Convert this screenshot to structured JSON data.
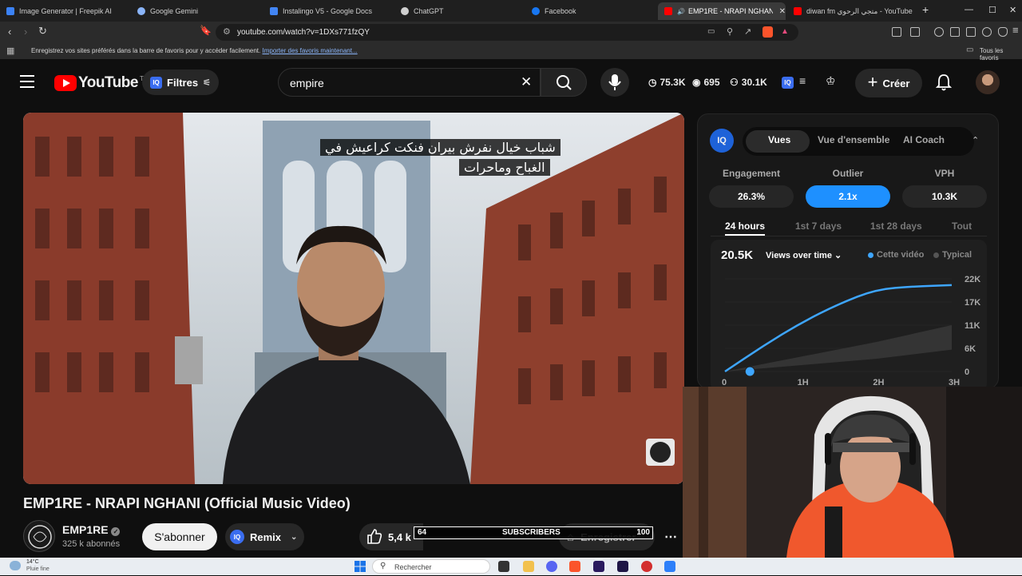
{
  "browser": {
    "tabs": [
      {
        "title": "Image Generator | Freepik AI",
        "favicon_color": "#3b82f6",
        "active": false
      },
      {
        "title": "Google Gemini",
        "favicon_color": "#8ab4f8",
        "active": false
      },
      {
        "title": "Instalingo V5 - Google Docs",
        "favicon_color": "#4285f4",
        "active": false
      },
      {
        "title": "ChatGPT",
        "favicon_color": "#cfcfcf",
        "active": false
      },
      {
        "title": "Facebook",
        "favicon_color": "#1877f2",
        "active": false
      },
      {
        "title": "EMP1RE - NRAPI NGHANI (O",
        "favicon_color": "#ff0000",
        "active": true
      },
      {
        "title": "diwan fm متجي الرحوي - YouTube",
        "favicon_color": "#ff0000",
        "active": false
      }
    ],
    "new_tab": "+",
    "url": "youtube.com/watch?v=1DXs771fzQY",
    "bookmarks_hint": "Enregistrez vos sites préférés dans la barre de favoris pour y accéder facilement.",
    "bookmarks_link": "Importer des favoris maintenant...",
    "all_favorites": "Tous les favoris"
  },
  "youtube": {
    "logo_text": "YouTube",
    "logo_region": "TN",
    "filters_label": "Filtres",
    "search_value": "empire",
    "header_stats": [
      {
        "icon": "clock-icon",
        "value": "75.3K"
      },
      {
        "icon": "eye-icon",
        "value": "695"
      },
      {
        "icon": "people-icon",
        "value": "30.1K"
      }
    ],
    "create_label": "Créer",
    "video": {
      "subtitle_line1": "شباب خيال نفرش بيران فنكت كراعيش في",
      "subtitle_line2": "الغباح وماحرات",
      "title": "EMP1RE - NRAPI NGHANI (Official Music Video)"
    },
    "channel": {
      "name": "EMP1RE",
      "subscribers": "325 k abonnés",
      "subscribe_label": "S'abonner",
      "remix_label": "Remix",
      "likes": "5,4 k",
      "save_label": "Enregistrer"
    },
    "overlay_bar": {
      "left": "64",
      "center": "SUBSCRIBERS",
      "right": "100"
    }
  },
  "panel": {
    "tabs": [
      "Vues",
      "Vue d'ensemble",
      "AI Coach"
    ],
    "active_tab": "Vues",
    "metrics": [
      {
        "label": "Engagement",
        "value": "26.3%",
        "highlight": false
      },
      {
        "label": "Outlier",
        "value": "2.1x",
        "highlight": true
      },
      {
        "label": "VPH",
        "value": "10.3K",
        "highlight": false
      }
    ],
    "ranges": [
      "24 hours",
      "1st 7 days",
      "1st 28 days",
      "Tout"
    ],
    "active_range": "24 hours",
    "total_views": "20.5K",
    "dropdown": "Views over time",
    "legend": [
      {
        "name": "Cette vidéo",
        "color": "#3ea6ff"
      },
      {
        "name": "Typical",
        "color": "#555555"
      }
    ],
    "accent_color": "#1e90ff"
  },
  "chart_data": {
    "type": "area",
    "y_ticks": [
      "22K",
      "17K",
      "11K",
      "6K",
      "0"
    ],
    "x_ticks": [
      "0",
      "1H",
      "2H",
      "3H"
    ],
    "ylim": [
      0,
      22000
    ],
    "xlim": [
      0,
      3
    ],
    "series": [
      {
        "name": "Cette vidéo",
        "type": "line",
        "color": "#3ea6ff",
        "x": [
          0,
          0.5,
          1,
          1.5,
          2,
          2.5,
          3
        ],
        "y": [
          0,
          6000,
          11500,
          16000,
          19500,
          20200,
          20500
        ]
      },
      {
        "name": "Typical",
        "type": "band",
        "color": "#3a3a3a",
        "x": [
          0,
          1,
          2,
          3
        ],
        "y_low": [
          0,
          1500,
          3000,
          5200
        ],
        "y_high": [
          0,
          3500,
          7000,
          11000
        ]
      }
    ]
  },
  "taskbar": {
    "weather_temp": "14°C",
    "weather_desc": "Pluie fine",
    "search_placeholder": "Rechercher"
  }
}
